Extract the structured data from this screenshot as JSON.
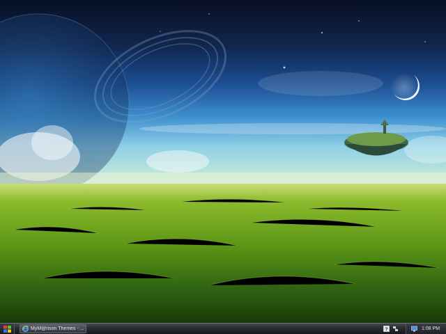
{
  "desktop": {
    "wallpaper": "fantasy-grass-field-with-planet-moon-and-floating-island",
    "colors": {
      "sky_top": "#0b1530",
      "sky_mid": "#1e5aa3",
      "horizon": "#bfe3e8",
      "grass": "#5f9a18"
    }
  },
  "taskbar": {
    "start_icon": "windows-flag-icon",
    "task_items": [
      {
        "label": "MyM@rison Themes - ...",
        "icon": "internet-explorer-icon"
      }
    ],
    "tray_icons": [
      "help-icon",
      "network-icon",
      "display-icon"
    ],
    "clock": "1:08 PM"
  }
}
